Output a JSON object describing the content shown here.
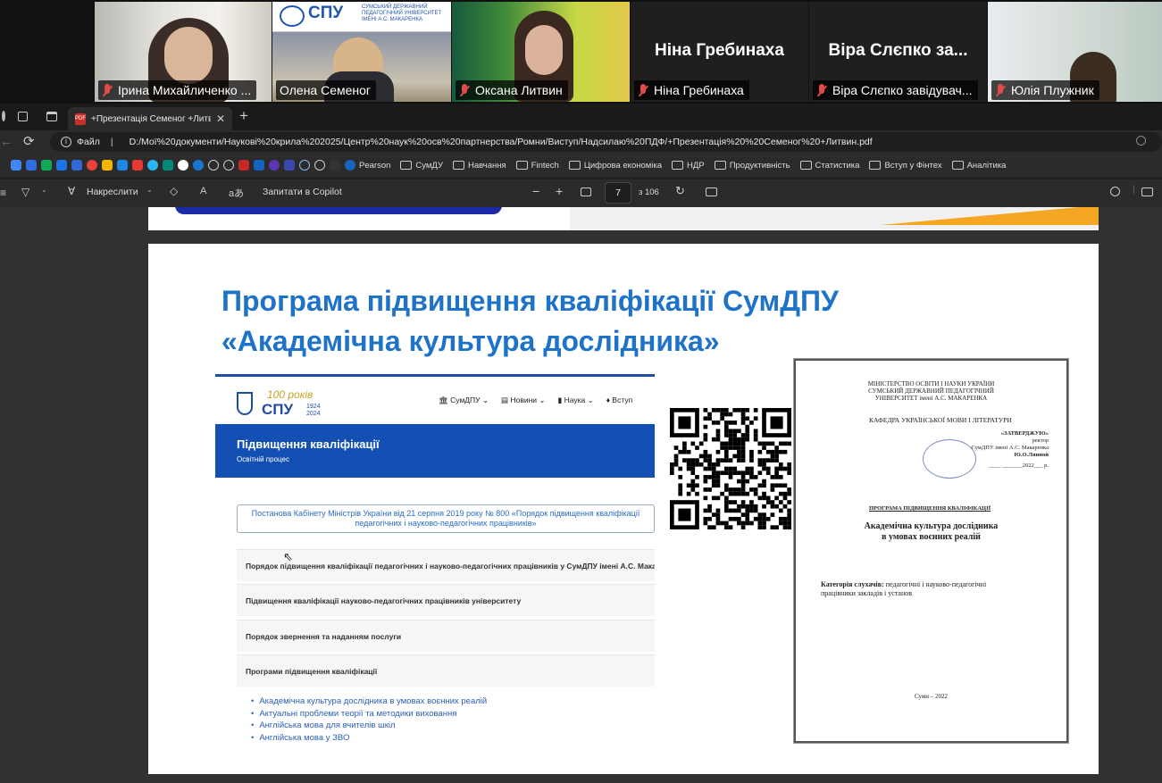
{
  "participants": [
    {
      "name": "Ірина Михайличенко ...",
      "muted": true
    },
    {
      "name": "Олена Семеног",
      "muted": false,
      "speaking": true
    },
    {
      "name": "Оксана Литвин",
      "muted": true
    },
    {
      "name": "Ніна Гребинаха",
      "muted": true,
      "big_name": "Ніна Гребинаха"
    },
    {
      "name": "Віра Слєпко завідувач...",
      "muted": true,
      "big_name": "Віра Слєпко за..."
    },
    {
      "name": "Юлія Плужник",
      "muted": true
    }
  ],
  "tile_text": {
    "spu_logo": "СПУ",
    "spu_caption": "СУМСЬКИЙ ДЕРЖАВНИЙ ПЕДАГОГІЧНИЙ УНІВЕРСИТЕТ ІМЕНІ А.С. МАКАРЕНКА"
  },
  "browser": {
    "tab_title": "+Презентація Семеног +Литвин",
    "file_label": "Файл",
    "url": "D:/Мої%20документи/Наукові%20крила%202025/Центр%20наук%20осв%20партнерства/Ромни/Виступ/Надсилаю%20ПДФ/+Презентація%20%20Семеног%20+Литвин.pdf",
    "bookmarks": [
      "Pearson",
      "СумДУ",
      "Навчання",
      "Fintech",
      "Цифрова економіка",
      "НДР",
      "Продуктивність",
      "Статистика",
      "Вступ у Фінтех",
      "Аналітика"
    ],
    "pdf_toolbar": {
      "draw_label": "Накреслити",
      "copilot_label": "Запитати в Copilot",
      "page_current": "7",
      "page_total": "з 106"
    }
  },
  "colors": {
    "title_blue": "#1e73c8",
    "site_blue": "#1450b4",
    "speaking_outline": "#23d18b",
    "muted_red": "#e24b4b"
  },
  "slide": {
    "title_line1": "Програма підвищення кваліфікації СумДПУ",
    "title_line2": "«Академічна культура дослідника»",
    "website": {
      "logo_years": "100 років",
      "logo_text": "СПУ",
      "logo_dates": "1924 2024",
      "nav": [
        "СумДПУ",
        "Новини",
        "Наука",
        "Вступ"
      ],
      "hero_title": "Підвищення кваліфікації",
      "hero_subtitle": "Освітній процес",
      "decree": "Постанова Кабінету Міністрів України від 21 серпня 2019 року № 800 «Порядок підвищення кваліфікації педагогічних і науково-педагогічних працівників»",
      "accordion": [
        "Порядок підвищення кваліфікації педагогічних і науково-педагогічних працівників у СумДПУ імені А.С. Макаренка",
        "Підвищення кваліфікації науково-педагогічних працівників університету",
        "Порядок звернення та наданням послуги",
        "Програми підвищення кваліфікації"
      ],
      "programs": [
        "Академічна культура дослідника в умовах воєнних реалій",
        "Актуальні проблеми теорії та методики виховання",
        "Англійська мова для вчителів шкіл",
        "Англійська мова у ЗВО"
      ]
    },
    "document": {
      "ministry": "МІНІСТЕРСТВО ОСВІТИ І НАУКИ УКРАЇНИ",
      "university_1": "СУМСЬКИЙ ДЕРЖАВНИЙ ПЕДАГОГІЧНИЙ",
      "university_2": "УНІВЕРСИТЕТ імені А.С. МАКАРЕНКА",
      "department": "КАФЕДРА УКРАЇНСЬКОЇ МОВИ І ЛІТЕРАТУРИ",
      "approve": "«ЗАТВЕРДЖУЮ»",
      "rector": "ректор",
      "rector_univ": "СумДПУ імені А.С. Макаренка",
      "rector_name": "Ю.О.Лянной",
      "approve_date": "____ _______2022___ р.",
      "program_label": "ПРОГРАМА ПІДВИЩЕННЯ КВАЛІФІКАЦІЇ",
      "program_title_1": "Академічна культура дослідника",
      "program_title_2": "в умовах воєнних реалій",
      "category_label": "Категорія слухачів:",
      "category_text_1": "педагогічні і науково-педагогічні",
      "category_text_2": "працівники закладів і установ",
      "city_year": "Суми – 2022"
    }
  }
}
